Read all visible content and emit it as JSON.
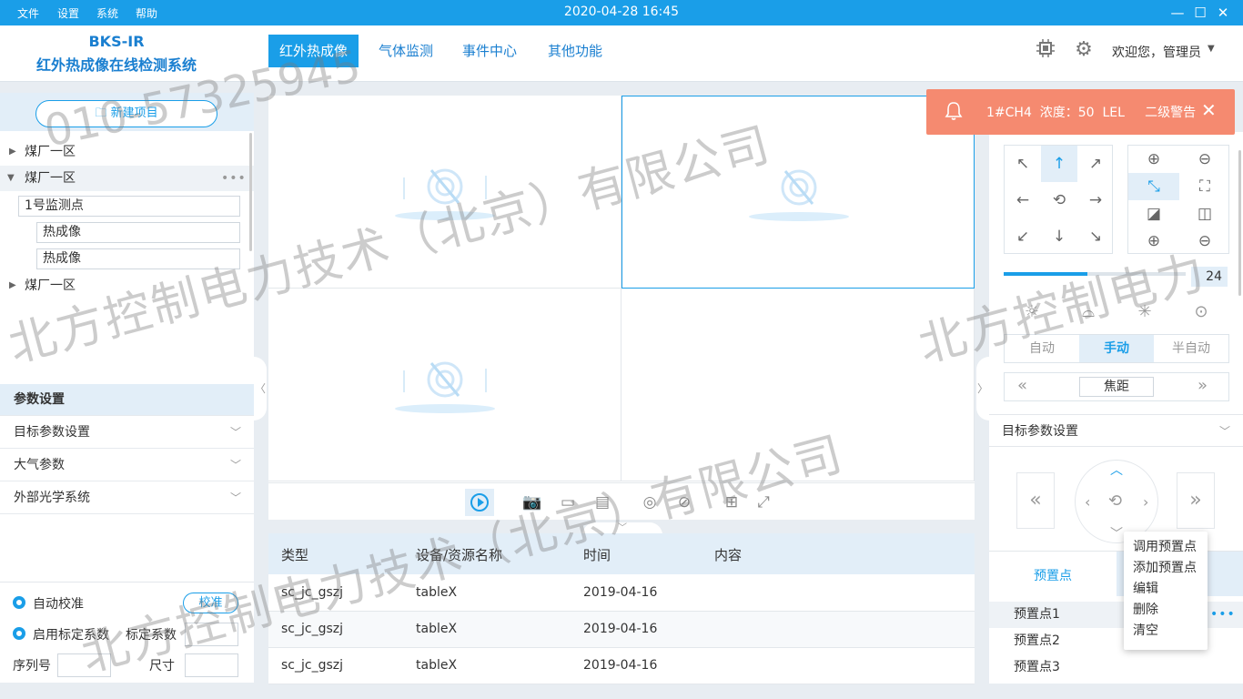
{
  "titlebar": {
    "menus": [
      "文件",
      "设置",
      "系统",
      "帮助"
    ],
    "datetime": "2020-04-28   16:45"
  },
  "header": {
    "app_name": "BKS-IR",
    "app_subtitle": "红外热成像在线检测系统",
    "tabs": [
      {
        "label": "红外热成像",
        "active": true
      },
      {
        "label": "气体监测",
        "active": false
      },
      {
        "label": "事件中心",
        "active": false
      },
      {
        "label": "其他功能",
        "active": false
      }
    ],
    "user": "欢迎您，管理员"
  },
  "alert": {
    "text": "1#CH4  浓度：50  LEL     二级警告"
  },
  "left": {
    "new_project": "新建项目",
    "tree": [
      {
        "label": "煤厂一区",
        "expanded": false
      },
      {
        "label": "煤厂一区",
        "expanded": true
      },
      {
        "label": "1号监测点"
      },
      {
        "label": "热成像"
      },
      {
        "label": "热成像"
      },
      {
        "label": "煤厂一区",
        "expanded": false
      }
    ],
    "sections": [
      "参数设置",
      "目标参数设置",
      "大气参数",
      "外部光学系统"
    ],
    "auto_calib": "自动校准",
    "calib_btn": "校准",
    "enable_coef": "启用标定系数",
    "coef_label": "标定系数",
    "serial_label": "序列号",
    "size_label": "尺寸"
  },
  "table": {
    "headers": [
      "类型",
      "设备/资源名称",
      "时间",
      "内容"
    ],
    "rows": [
      [
        "sc_jc_gszj",
        "tableX",
        "2019-04-16",
        ""
      ],
      [
        "sc_jc_gszj",
        "tableX",
        "2019-04-16",
        ""
      ],
      [
        "sc_jc_gszj",
        "tableX",
        "2019-04-16",
        ""
      ]
    ]
  },
  "right": {
    "slider_value": "24",
    "slider_level": 0.46,
    "modes": [
      {
        "label": "自动",
        "active": false
      },
      {
        "label": "手动",
        "active": true
      },
      {
        "label": "半自动",
        "active": false
      }
    ],
    "focus_label": "焦距",
    "target_section": "目标参数设置",
    "preset_tab": "预置点",
    "presets": [
      "预置点1",
      "预置点2",
      "预置点3"
    ]
  },
  "context_menu": [
    "调用预置点",
    "添加预置点",
    "编辑",
    "删除",
    "清空"
  ],
  "watermarks": [
    "010-57325945",
    "北方控制电力技术（北京）有限公司",
    "北方控制电力",
    "北方控制电力技术（北京）有限公司"
  ],
  "colors": {
    "accent": "#1a9ee8",
    "alert": "#f58a70",
    "nav_text": "#1a7fd0"
  }
}
